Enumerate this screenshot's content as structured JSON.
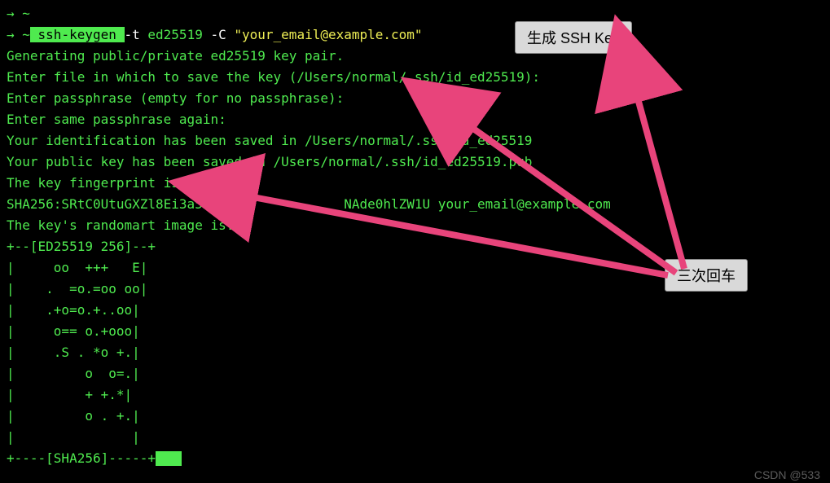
{
  "terminal": {
    "prompt1_arrow": "→",
    "prompt1_tilde": " ~",
    "prompt2_arrow": "→",
    "prompt2_tilde": " ~",
    "cmd_name": " ssh-keygen ",
    "cmd_flag1": "-t",
    "cmd_val1": " ed25519 ",
    "cmd_flag2": "-C",
    "cmd_space": " ",
    "cmd_quoted": "\"your_email@example.com\"",
    "line3": "Generating public/private ed25519 key pair.",
    "line4": "Enter file in which to save the key (/Users/normal/.ssh/id_ed25519):",
    "line5": "Enter passphrase (empty for no passphrase):",
    "line6": "Enter same passphrase again:",
    "line7": "Your identification has been saved in /Users/normal/.ssh/id_ed25519",
    "line8": "Your public key has been saved in /Users/normal/.ssh/id_ed25519.pub",
    "line9": "The key fingerprint is:",
    "line10": "SHA256:SRtC0UtuGXZl8Ei3a5xJ/W              NAde0hlZW1U your_email@example.com",
    "line11": "The key's randomart image is:",
    "line12": "+--[ED25519 256]--+",
    "line13": "|     oo  +++   E|",
    "line14": "|    .  =o.=oo oo|",
    "line15": "|    .+o=o.+..oo|",
    "line16": "|     o== o.+ooo|",
    "line17": "|     .S . *o +.|",
    "line18": "|         o  o=.|",
    "line19": "|         + +.*|",
    "line20": "|         o . +.|",
    "line21": "|               |",
    "line22": "+----[SHA256]-----+"
  },
  "labels": {
    "top": "生成 SSH Key",
    "bottom": "三次回车"
  },
  "watermark": "CSDN @533"
}
